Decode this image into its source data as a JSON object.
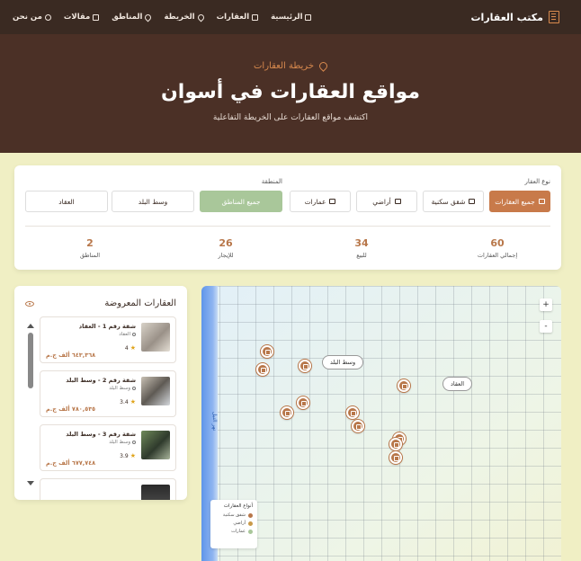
{
  "nav": {
    "brand": "مكتب العقارات",
    "links": [
      {
        "label": "الرئيسية",
        "icon": "home-icon"
      },
      {
        "label": "العقارات",
        "icon": "building-icon"
      },
      {
        "label": "الخريطة",
        "icon": "map-pin-icon"
      },
      {
        "label": "المناطق",
        "icon": "map-pin-icon"
      },
      {
        "label": "مقالات",
        "icon": "document-icon"
      },
      {
        "label": "من نحن",
        "icon": "users-icon"
      }
    ]
  },
  "hero": {
    "subtitle": "خريطة العقارات",
    "title": "مواقع العقارات في أسوان",
    "description": "اكتشف مواقع العقارات على الخريطة التفاعلية"
  },
  "filters": {
    "type_label": "نوع العقار",
    "types": [
      "جميع العقارات",
      "شقق سكنية",
      "أراضي",
      "عمارات"
    ],
    "area_label": "المنطقة",
    "areas": [
      "جميع المناطق",
      "وسط البلد",
      "العقاد"
    ]
  },
  "stats": [
    {
      "value": "60",
      "label": "إجمالي العقارات"
    },
    {
      "value": "34",
      "label": "للبيع"
    },
    {
      "value": "26",
      "label": "للإيجار"
    },
    {
      "value": "2",
      "label": "المناطق"
    }
  ],
  "properties": {
    "title": "العقارات المعروضة",
    "items": [
      {
        "name": "شقة رقم 1 - العقاد",
        "location": "العقاد",
        "rating": "4",
        "price": "٦٤٣,٣٦٨ ألف ج.م"
      },
      {
        "name": "شقة رقم 2 - وسط البلد",
        "location": "وسط البلد",
        "rating": "3.4",
        "price": "٧٨٠,٥٣٥ ألف ج.م"
      },
      {
        "name": "شقة رقم 3 - وسط البلد",
        "location": "وسط البلد",
        "rating": "3.9",
        "price": "٦٧٧,٧٤٨ ألف ج.م"
      }
    ]
  },
  "map": {
    "river_label": "نهر النيل",
    "zoom_in": "+",
    "zoom_out": "-",
    "area_labels": [
      "وسط البلد",
      "العقاد"
    ],
    "legend": {
      "title": "أنواع العقارات",
      "items": [
        {
          "label": "شقق سكنية",
          "color": "#b8774a"
        },
        {
          "label": "أراضي",
          "color": "#c99a4a"
        },
        {
          "label": "عمارات",
          "color": "#a9c79a"
        }
      ]
    }
  },
  "colors": {
    "accent": "#c87a4a",
    "header_bg": "#3a2a22",
    "hero_bg": "#4b3026",
    "active_area": "#a9c79a",
    "page_bg": "#f0efc4"
  }
}
